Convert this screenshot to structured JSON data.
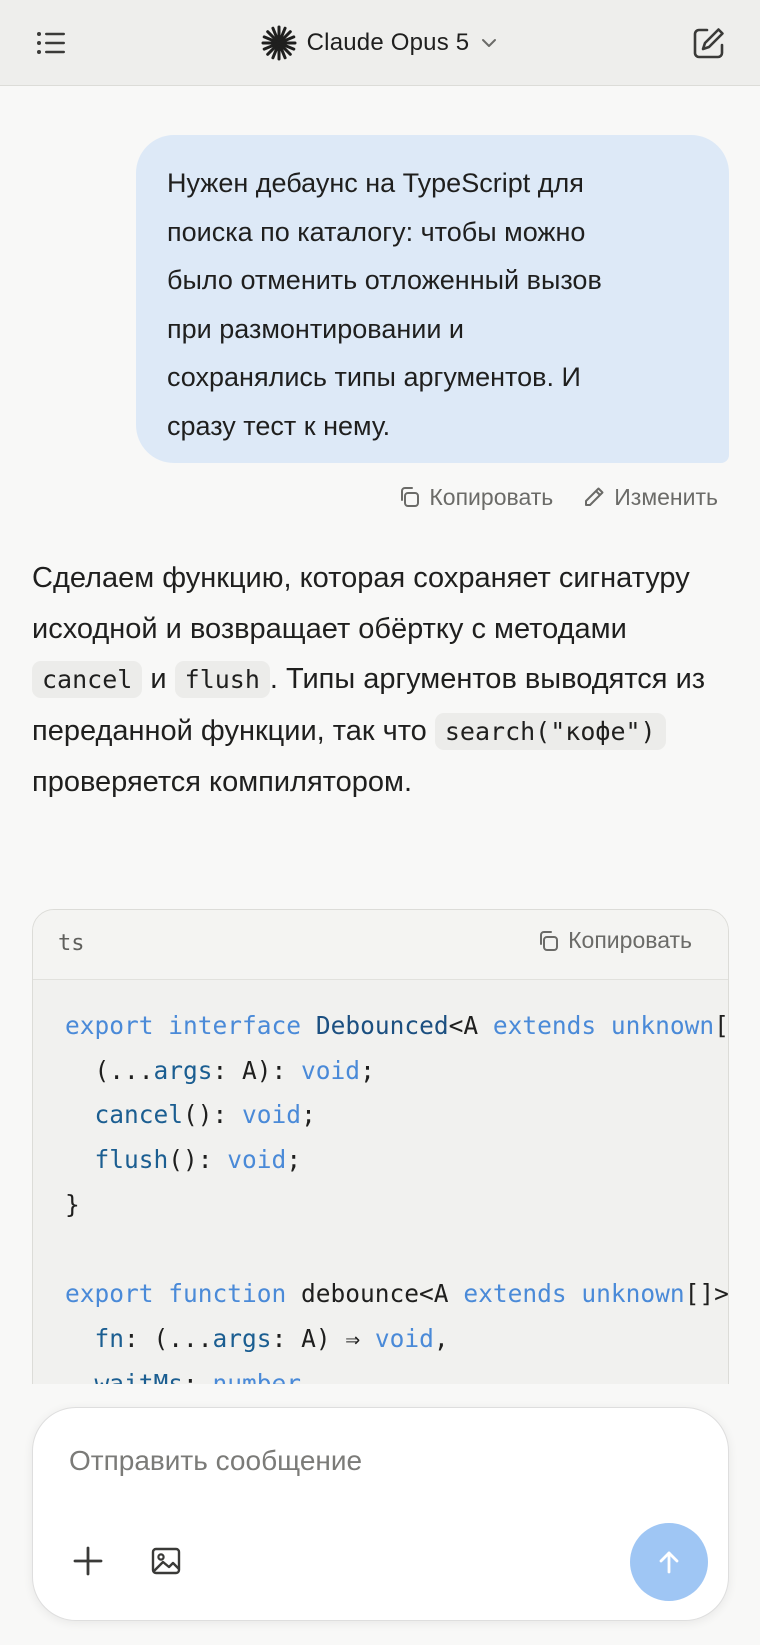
{
  "header": {
    "model_name": "Claude Opus 5",
    "icons": {
      "menu": "list-icon",
      "model_logo": "sparkle-icon",
      "chevron": "chevron-down-icon",
      "new_chat": "edit-icon"
    }
  },
  "conversation": {
    "user_message": {
      "lines": [
        "Нужен дебаунс на TypeScript для",
        "поиска по каталогу: чтобы можно",
        "было отменить отложенный вызов",
        "при размонтировании и",
        "сохранялись типы аргументов. И",
        "сразу тест к нему."
      ],
      "actions": {
        "copy_label": "Копировать",
        "edit_label": "Изменить"
      }
    },
    "assistant_message": {
      "part1": "Сделаем функцию, которая сохраняет сигнатуру исходной и возвращает обёртку с методами",
      "code1": "cancel",
      "part2": "и",
      "code2": "flush",
      "part3": ". Типы аргументов выводятся из переданной функции, так что",
      "code3": "search(\"кофе\")",
      "part4": "проверяется компилятором."
    },
    "code_block": {
      "language": "ts",
      "copy_label": "Копировать",
      "lines": [
        [
          [
            "kw",
            "export"
          ],
          [
            "pl",
            " "
          ],
          [
            "kw",
            "interface"
          ],
          [
            "pl",
            " "
          ],
          [
            "ty",
            "Debounced"
          ],
          [
            "pl",
            "<A "
          ],
          [
            "kw",
            "extends"
          ],
          [
            "pl",
            " "
          ],
          [
            "kw",
            "unknown"
          ],
          [
            "pl",
            "[]> {"
          ]
        ],
        [
          [
            "pl",
            "  (..."
          ],
          [
            "id",
            "args"
          ],
          [
            "pl",
            ": A): "
          ],
          [
            "kw",
            "void"
          ],
          [
            "pl",
            ";"
          ]
        ],
        [
          [
            "pl",
            "  "
          ],
          [
            "id",
            "cancel"
          ],
          [
            "pl",
            "(): "
          ],
          [
            "kw",
            "void"
          ],
          [
            "pl",
            ";"
          ]
        ],
        [
          [
            "pl",
            "  "
          ],
          [
            "id",
            "flush"
          ],
          [
            "pl",
            "(): "
          ],
          [
            "kw",
            "void"
          ],
          [
            "pl",
            ";"
          ]
        ],
        [
          [
            "pl",
            "}"
          ]
        ],
        [
          [
            "pl",
            ""
          ]
        ],
        [
          [
            "kw",
            "export"
          ],
          [
            "pl",
            " "
          ],
          [
            "kw",
            "function"
          ],
          [
            "pl",
            " debounce<A "
          ],
          [
            "kw",
            "extends"
          ],
          [
            "pl",
            " "
          ],
          [
            "kw",
            "unknown"
          ],
          [
            "pl",
            "[]>("
          ]
        ],
        [
          [
            "pl",
            "  "
          ],
          [
            "id",
            "fn"
          ],
          [
            "pl",
            ": (..."
          ],
          [
            "id",
            "args"
          ],
          [
            "pl",
            ": A) ⇒ "
          ],
          [
            "kw",
            "void"
          ],
          [
            "pl",
            ","
          ]
        ],
        [
          [
            "pl",
            "  "
          ],
          [
            "id",
            "waitMs"
          ],
          [
            "pl",
            ": "
          ],
          [
            "kw",
            "number"
          ]
        ]
      ]
    }
  },
  "composer": {
    "placeholder": "Отправить сообщение",
    "value": "",
    "icons": {
      "attach": "plus-icon",
      "image": "image-icon",
      "send": "arrow-up-icon"
    }
  },
  "colors": {
    "header_bg": "#eeeeec",
    "page_bg": "#f8f8f7",
    "user_bubble": "#dde9f7",
    "send_button": "#9fc6f4",
    "code_keyword": "#4a8ad8",
    "code_type": "#1b4f80"
  }
}
